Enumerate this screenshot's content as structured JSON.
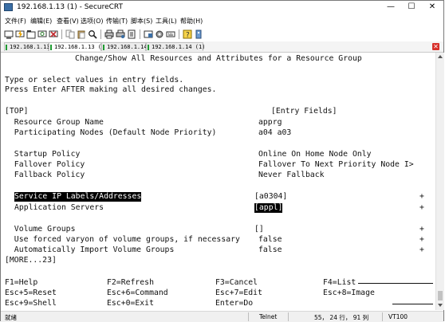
{
  "window": {
    "title": "192.168.1.13 (1) - SecureCRT",
    "minimize": "—",
    "maximize": "☐",
    "close": "✕"
  },
  "menu": [
    "文件(F)",
    "编辑(E)",
    "查看(V)",
    "选项(O)",
    "传输(T)",
    "脚本(S)",
    "工具(L)",
    "帮助(H)"
  ],
  "toolbar_icons": [
    "connect-icon",
    "quick-connect-icon",
    "connect-tab-icon",
    "reconnect-icon",
    "disconnect-icon",
    "copy-icon",
    "paste-icon",
    "find-icon",
    "print-icon",
    "print-setup-icon",
    "log-icon",
    "session-options-icon",
    "global-options-icon",
    "keymap-icon",
    "help-icon",
    "about-icon"
  ],
  "tabs": [
    {
      "label": "192.168.1.13",
      "active": false
    },
    {
      "label": "192.168.1.13 (1)",
      "active": true
    },
    {
      "label": "192.168.1.14",
      "active": false
    },
    {
      "label": "192.168.1.14 (1)",
      "active": false
    }
  ],
  "terminal": {
    "header": "Change/Show All Resources and Attributes for a Resource Group",
    "instr1": "Type or select values in entry fields.",
    "instr2": "Press Enter AFTER making all desired changes.",
    "top": "[TOP]",
    "entry_fields": "[Entry Fields]",
    "fields": [
      {
        "label": "  Resource Group Name",
        "value": "apprg",
        "suffix": ""
      },
      {
        "label": "  Participating Nodes (Default Node Priority)",
        "value": "a04 a03",
        "suffix": ""
      },
      {
        "label": "  Startup Policy",
        "value": "Online On Home Node Only",
        "suffix": ""
      },
      {
        "label": "  Fallover Policy",
        "value": "Fallover To Next Priority Node I>",
        "suffix": ""
      },
      {
        "label": "  Fallback Policy",
        "value": "Never Fallback",
        "suffix": ""
      },
      {
        "label": "Service IP Labels/Addresses",
        "value": "[a0304]",
        "suffix": "+"
      },
      {
        "label": "Application Servers",
        "value": "[appl]",
        "suffix": "+"
      },
      {
        "label": "  Volume Groups",
        "value": "[]",
        "suffix": "+"
      },
      {
        "label": "  Use forced varyon of volume groups, if necessary",
        "value": "false",
        "suffix": "+"
      },
      {
        "label": "  Automatically Import Volume Groups",
        "value": "false",
        "suffix": "+"
      }
    ],
    "more": "[MORE...23]",
    "fkeys": [
      [
        "F1=Help",
        "F2=Refresh",
        "F3=Cancel",
        "F4=List"
      ],
      [
        "Esc+5=Reset",
        "Esc+6=Command",
        "Esc+7=Edit",
        "Esc+8=Image"
      ],
      [
        "Esc+9=Shell",
        "Esc+0=Exit",
        "Enter=Do",
        ""
      ]
    ]
  },
  "status": {
    "ready": "就绪",
    "protocol": "Telnet",
    "position": "55，  24 行，  91 列",
    "emulation": "VT100"
  },
  "colors": {
    "tab_mark": "#1f9b32",
    "close_tab": "#d7302a",
    "highlight_bg": "#000000"
  }
}
